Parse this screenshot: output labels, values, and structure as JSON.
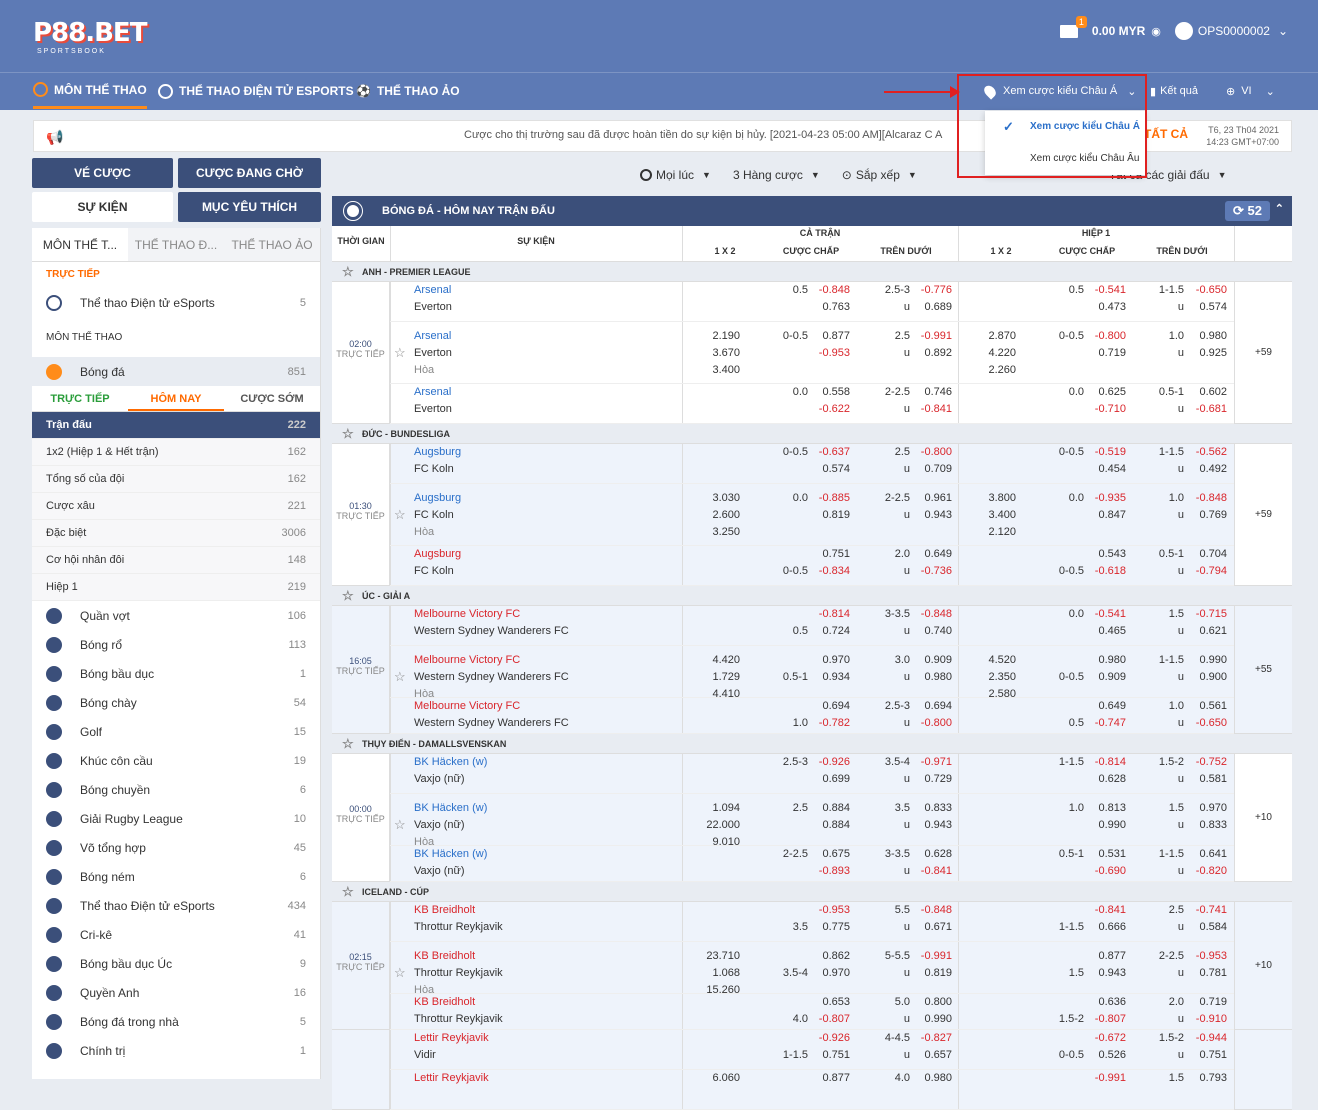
{
  "brand": {
    "logo": "P88.BET",
    "sub": "SPORTSBOOK"
  },
  "header": {
    "mail_badge": "1",
    "balance": "0.00 MYR",
    "username": "OPS0000002"
  },
  "nav": {
    "items": [
      "MÔN THỂ THAO",
      "THỂ THAO ĐIỆN TỬ ESPORTS",
      "THỂ THAO ẢO"
    ],
    "odds_view": "Xem cược kiểu Châu Á",
    "results": "Kết quả",
    "lang": "VI"
  },
  "odds_dropdown": {
    "options": [
      "Xem cược kiểu Châu Á",
      "Xem cược kiểu Châu Âu"
    ],
    "selected": "Xem cược kiểu Châu Á"
  },
  "ticker": {
    "text": "Cược cho thị trường sau đã được hoàn tiền do sự kiện bị hủy. [2021-04-23 05:00 AM][Alcaraz C A",
    "button": "TẤT CẢ",
    "date": "T6, 23 Th04 2021",
    "time": "14:23 GMT+07:00"
  },
  "left_buttons": {
    "bet_slip": "VÉ CƯỢC",
    "pending": "CƯỢC ĐANG CHỜ",
    "events": "SỰ KIỆN",
    "favorites": "MỤC YÊU THÍCH"
  },
  "sidebar": {
    "tabs": [
      "MÔN THỂ T...",
      "THỂ THAO Đ...",
      "THỂ THAO ẢO"
    ],
    "live_label": "TRỰC TIẾP",
    "live_items": [
      {
        "label": "Thể thao Điện tử eSports",
        "count": "5"
      }
    ],
    "sports_label": "MÔN THỂ THAO",
    "football": {
      "label": "Bóng đá",
      "count": "851"
    },
    "subtabs": [
      "TRỰC TIẾP",
      "HÔM NAY",
      "CƯỢC SỚM"
    ],
    "categories": [
      {
        "label": "Trận đấu",
        "count": "222"
      },
      {
        "label": "1x2 (Hiệp 1 & Hết trận)",
        "count": "162"
      },
      {
        "label": "Tổng số của đội",
        "count": "162"
      },
      {
        "label": "Cược xâu",
        "count": "221"
      },
      {
        "label": "Đặc biệt",
        "count": "3006"
      },
      {
        "label": "Cơ hội nhân đôi",
        "count": "148"
      },
      {
        "label": "Hiệp 1",
        "count": "219"
      }
    ],
    "sports": [
      {
        "label": "Quần vợt",
        "count": "106"
      },
      {
        "label": "Bóng rổ",
        "count": "113"
      },
      {
        "label": "Bóng bầu dục",
        "count": "1"
      },
      {
        "label": "Bóng chày",
        "count": "54"
      },
      {
        "label": "Golf",
        "count": "15"
      },
      {
        "label": "Khúc côn cầu",
        "count": "19"
      },
      {
        "label": "Bóng chuyền",
        "count": "6"
      },
      {
        "label": "Giải Rugby League",
        "count": "10"
      },
      {
        "label": "Võ tổng hợp",
        "count": "45"
      },
      {
        "label": "Bóng ném",
        "count": "6"
      },
      {
        "label": "Thể thao Điện tử eSports",
        "count": "434"
      },
      {
        "label": "Cri-kê",
        "count": "41"
      },
      {
        "label": "Bóng bầu dục Úc",
        "count": "9"
      },
      {
        "label": "Quyền Anh",
        "count": "16"
      },
      {
        "label": "Bóng đá trong nhà",
        "count": "5"
      },
      {
        "label": "Chính trị",
        "count": "1"
      }
    ]
  },
  "filters": {
    "time": "Mọi lúc",
    "lines": "3 Hàng cược",
    "sort": "Sắp xếp",
    "leagues": "Tất cả các giải đấu"
  },
  "main": {
    "title": "BÓNG ĐÁ - HÔM NAY TRẬN ĐẤU",
    "count": "52",
    "cols": {
      "time": "THỜI GIAN",
      "event": "SỰ KIỆN",
      "full": "CẢ TRẬN",
      "half": "HIỆP 1",
      "x12": "1 X 2",
      "hdp": "CƯỢC CHẤP",
      "ou": "TRÊN DƯỚI"
    },
    "live_text": "TRỰC TIẾP",
    "groups": [
      {
        "league": "ANH - PREMIER LEAGUE",
        "time": "02:00",
        "more": "+59",
        "rows": [
          {
            "h": 40,
            "home": "Arsenal",
            "away": "Everton",
            "fav": "home",
            "x12": [],
            "fhdp_l": [
              "0.5",
              ""
            ],
            "fhdp": [
              "-0.848",
              "0.763"
            ],
            "fou_l": [
              "2.5-3",
              "u"
            ],
            "fou": [
              "-0.776",
              "0.689"
            ],
            "hx12": [],
            "hhdp_l": [
              "0.5",
              ""
            ],
            "hhdp": [
              "-0.541",
              "0.473"
            ],
            "hou_l": [
              "1-1.5",
              "u"
            ],
            "hou": [
              "-0.650",
              "0.574"
            ]
          },
          {
            "h": 62,
            "home": "Arsenal",
            "away": "Everton",
            "draw": "Hòa",
            "fav": "home",
            "x12": [
              "2.190",
              "3.670",
              "3.400"
            ],
            "fhdp_l": [
              "0-0.5",
              ""
            ],
            "fhdp": [
              "0.877",
              "-0.953"
            ],
            "fou_l": [
              "2.5",
              "u"
            ],
            "fou": [
              "-0.991",
              "0.892"
            ],
            "hx12": [
              "2.870",
              "4.220",
              "2.260"
            ],
            "hhdp_l": [
              "0-0.5",
              ""
            ],
            "hhdp": [
              "-0.800",
              "0.719"
            ],
            "hou_l": [
              "1.0",
              "u"
            ],
            "hou": [
              "0.980",
              "0.925"
            ]
          },
          {
            "h": 40,
            "home": "Arsenal",
            "away": "Everton",
            "fav": "home",
            "x12": [],
            "fhdp_l": [
              "0.0",
              ""
            ],
            "fhdp": [
              "0.558",
              "-0.622"
            ],
            "fou_l": [
              "2-2.5",
              "u"
            ],
            "fou": [
              "0.746",
              "-0.841"
            ],
            "hx12": [],
            "hhdp_l": [
              "0.0",
              ""
            ],
            "hhdp": [
              "0.625",
              "-0.710"
            ],
            "hou_l": [
              "0.5-1",
              "u"
            ],
            "hou": [
              "0.602",
              "-0.681"
            ]
          }
        ]
      },
      {
        "league": "ĐỨC - BUNDESLIGA",
        "time": "01:30",
        "more": "+59",
        "rows": [
          {
            "h": 40,
            "home": "Augsburg",
            "away": "FC Koln",
            "fav": "home",
            "x12": [],
            "fhdp_l": [
              "0-0.5",
              ""
            ],
            "fhdp": [
              "-0.637",
              "0.574"
            ],
            "fou_l": [
              "2.5",
              "u"
            ],
            "fou": [
              "-0.800",
              "0.709"
            ],
            "hx12": [],
            "hhdp_l": [
              "0-0.5",
              ""
            ],
            "hhdp": [
              "-0.519",
              "0.454"
            ],
            "hou_l": [
              "1-1.5",
              "u"
            ],
            "hou": [
              "-0.562",
              "0.492"
            ]
          },
          {
            "h": 62,
            "home": "Augsburg",
            "away": "FC Koln",
            "draw": "Hòa",
            "fav": "home",
            "x12": [
              "3.030",
              "2.600",
              "3.250"
            ],
            "fhdp_l": [
              "0.0",
              ""
            ],
            "fhdp": [
              "-0.885",
              "0.819"
            ],
            "fou_l": [
              "2-2.5",
              "u"
            ],
            "fou": [
              "0.961",
              "0.943"
            ],
            "hx12": [
              "3.800",
              "3.400",
              "2.120"
            ],
            "hhdp_l": [
              "0.0",
              ""
            ],
            "hhdp": [
              "-0.935",
              "0.847"
            ],
            "hou_l": [
              "1.0",
              "u"
            ],
            "hou": [
              "-0.848",
              "0.769"
            ]
          },
          {
            "h": 40,
            "home": "Augsburg",
            "away": "FC Koln",
            "fav": "redhome",
            "x12": [],
            "fhdp_l": [
              "",
              "0-0.5"
            ],
            "fhdp": [
              "0.751",
              "-0.834"
            ],
            "fou_l": [
              "2.0",
              "u"
            ],
            "fou": [
              "0.649",
              "-0.736"
            ],
            "hx12": [],
            "hhdp_l": [
              "",
              "0-0.5"
            ],
            "hhdp": [
              "0.543",
              "-0.618"
            ],
            "hou_l": [
              "0.5-1",
              "u"
            ],
            "hou": [
              "0.704",
              "-0.794"
            ]
          }
        ]
      },
      {
        "league": "ÚC - GIẢI A",
        "time": "16:05",
        "more": "+55",
        "rows": [
          {
            "h": 40,
            "home": "Melbourne Victory FC",
            "away": "Western Sydney Wanderers FC",
            "fav": "redhome",
            "x12": [],
            "fhdp_l": [
              "",
              "0.5"
            ],
            "fhdp": [
              "-0.814",
              "0.724"
            ],
            "fou_l": [
              "3-3.5",
              "u"
            ],
            "fou": [
              "-0.848",
              "0.740"
            ],
            "hx12": [],
            "hhdp_l": [
              "0.0",
              ""
            ],
            "hhdp": [
              "-0.541",
              "0.465"
            ],
            "hou_l": [
              "1.5",
              "u"
            ],
            "hou": [
              "-0.715",
              "0.621"
            ]
          },
          {
            "h": 52,
            "home": "Melbourne Victory FC",
            "away": "Western Sydney Wanderers FC",
            "draw": "Hòa",
            "fav": "redhome",
            "x12": [
              "4.420",
              "1.729",
              "4.410"
            ],
            "fhdp_l": [
              "",
              "0.5-1"
            ],
            "fhdp": [
              "0.970",
              "0.934"
            ],
            "fou_l": [
              "3.0",
              "u"
            ],
            "fou": [
              "0.909",
              "0.980"
            ],
            "hx12": [
              "4.520",
              "2.350",
              "2.580"
            ],
            "hhdp_l": [
              "",
              "0-0.5"
            ],
            "hhdp": [
              "0.980",
              "0.909"
            ],
            "hou_l": [
              "1-1.5",
              "u"
            ],
            "hou": [
              "0.990",
              "0.900"
            ]
          },
          {
            "h": 36,
            "home": "Melbourne Victory FC",
            "away": "Western Sydney Wanderers FC",
            "fav": "redhome",
            "x12": [],
            "fhdp_l": [
              "",
              "1.0"
            ],
            "fhdp": [
              "0.694",
              "-0.782"
            ],
            "fou_l": [
              "2.5-3",
              "u"
            ],
            "fou": [
              "0.694",
              "-0.800"
            ],
            "hx12": [],
            "hhdp_l": [
              "",
              "0.5"
            ],
            "hhdp": [
              "0.649",
              "-0.747"
            ],
            "hou_l": [
              "1.0",
              "u"
            ],
            "hou": [
              "0.561",
              "-0.650"
            ]
          }
        ]
      },
      {
        "league": "THỤY ĐIỂN - DAMALLSVENSKAN",
        "time": "00:00",
        "more": "+10",
        "rows": [
          {
            "h": 40,
            "home": "BK Häcken (w)",
            "away": "Vaxjo (nữ)",
            "fav": "home",
            "x12": [],
            "fhdp_l": [
              "2.5-3",
              ""
            ],
            "fhdp": [
              "-0.926",
              "0.699"
            ],
            "fou_l": [
              "3.5-4",
              "u"
            ],
            "fou": [
              "-0.971",
              "0.729"
            ],
            "hx12": [],
            "hhdp_l": [
              "1-1.5",
              ""
            ],
            "hhdp": [
              "-0.814",
              "0.628"
            ],
            "hou_l": [
              "1.5-2",
              "u"
            ],
            "hou": [
              "-0.752",
              "0.581"
            ]
          },
          {
            "h": 52,
            "home": "BK Häcken (w)",
            "away": "Vaxjo (nữ)",
            "draw": "Hòa",
            "fav": "home",
            "x12": [
              "1.094",
              "22.000",
              "9.010"
            ],
            "fhdp_l": [
              "2.5",
              ""
            ],
            "fhdp": [
              "0.884",
              "0.884"
            ],
            "fou_l": [
              "3.5",
              "u"
            ],
            "fou": [
              "0.833",
              "0.943"
            ],
            "hx12": [],
            "hhdp_l": [
              "1.0",
              ""
            ],
            "hhdp": [
              "0.813",
              "0.990"
            ],
            "hou_l": [
              "1.5",
              "u"
            ],
            "hou": [
              "0.970",
              "0.833"
            ]
          },
          {
            "h": 36,
            "home": "BK Häcken (w)",
            "away": "Vaxjo (nữ)",
            "fav": "home",
            "x12": [],
            "fhdp_l": [
              "2-2.5",
              ""
            ],
            "fhdp": [
              "0.675",
              "-0.893"
            ],
            "fou_l": [
              "3-3.5",
              "u"
            ],
            "fou": [
              "0.628",
              "-0.841"
            ],
            "hx12": [],
            "hhdp_l": [
              "0.5-1",
              ""
            ],
            "hhdp": [
              "0.531",
              "-0.690"
            ],
            "hou_l": [
              "1-1.5",
              "u"
            ],
            "hou": [
              "0.641",
              "-0.820"
            ]
          }
        ]
      },
      {
        "league": "ICELAND - CÚP",
        "time": "02:15",
        "more": "+10",
        "rows": [
          {
            "h": 40,
            "home": "KB Breidholt",
            "away": "Throttur Reykjavik",
            "fav": "redhome",
            "x12": [],
            "fhdp_l": [
              "",
              "3.5"
            ],
            "fhdp": [
              "-0.953",
              "0.775"
            ],
            "fou_l": [
              "5.5",
              "u"
            ],
            "fou": [
              "-0.848",
              "0.671"
            ],
            "hx12": [],
            "hhdp_l": [
              "",
              "1-1.5"
            ],
            "hhdp": [
              "-0.841",
              "0.666"
            ],
            "hou_l": [
              "2.5",
              "u"
            ],
            "hou": [
              "-0.741",
              "0.584"
            ]
          },
          {
            "h": 52,
            "home": "KB Breidholt",
            "away": "Throttur Reykjavik",
            "draw": "Hòa",
            "fav": "redhome",
            "x12": [
              "23.710",
              "1.068",
              "15.260"
            ],
            "fhdp_l": [
              "",
              "3.5-4"
            ],
            "fhdp": [
              "0.862",
              "0.970"
            ],
            "fou_l": [
              "5-5.5",
              "u"
            ],
            "fou": [
              "-0.991",
              "0.819"
            ],
            "hx12": [],
            "hhdp_l": [
              "",
              "1.5"
            ],
            "hhdp": [
              "0.877",
              "0.943"
            ],
            "hou_l": [
              "2-2.5",
              "u"
            ],
            "hou": [
              "-0.953",
              "0.781"
            ]
          },
          {
            "h": 36,
            "home": "KB Breidholt",
            "away": "Throttur Reykjavik",
            "fav": "redhome",
            "x12": [],
            "fhdp_l": [
              "",
              "4.0"
            ],
            "fhdp": [
              "0.653",
              "-0.807"
            ],
            "fou_l": [
              "5.0",
              "u"
            ],
            "fou": [
              "0.800",
              "0.990"
            ],
            "hx12": [],
            "hhdp_l": [
              "",
              "1.5-2"
            ],
            "hhdp": [
              "0.636",
              "-0.807"
            ],
            "hou_l": [
              "2.0",
              "u"
            ],
            "hou": [
              "0.719",
              "-0.910"
            ]
          }
        ]
      },
      {
        "league": "",
        "time": "",
        "more": "",
        "rows": [
          {
            "h": 40,
            "home": "Lettir Reykjavik",
            "away": "Vidir",
            "fav": "redhome",
            "x12": [],
            "fhdp_l": [
              "",
              "1-1.5"
            ],
            "fhdp": [
              "-0.926",
              "0.751"
            ],
            "fou_l": [
              "4-4.5",
              "u"
            ],
            "fou": [
              "-0.827",
              "0.657"
            ],
            "hx12": [],
            "hhdp_l": [
              "",
              "0-0.5"
            ],
            "hhdp": [
              "-0.672",
              "0.526"
            ],
            "hou_l": [
              "1.5-2",
              "u"
            ],
            "hou": [
              "-0.944",
              "0.751"
            ]
          },
          {
            "h": 40,
            "home": "Lettir Reykjavik",
            "away": "",
            "fav": "redhome",
            "x12": [
              "6.060"
            ],
            "fhdp_l": [
              "",
              ""
            ],
            "fhdp": [
              "0.877",
              ""
            ],
            "fou_l": [
              "4.0",
              ""
            ],
            "fou": [
              "0.980",
              ""
            ],
            "hx12": [],
            "hhdp_l": [
              "",
              ""
            ],
            "hhdp": [
              "-0.991",
              ""
            ],
            "hou_l": [
              "1.5",
              ""
            ],
            "hou": [
              "0.793",
              ""
            ]
          }
        ]
      }
    ]
  }
}
